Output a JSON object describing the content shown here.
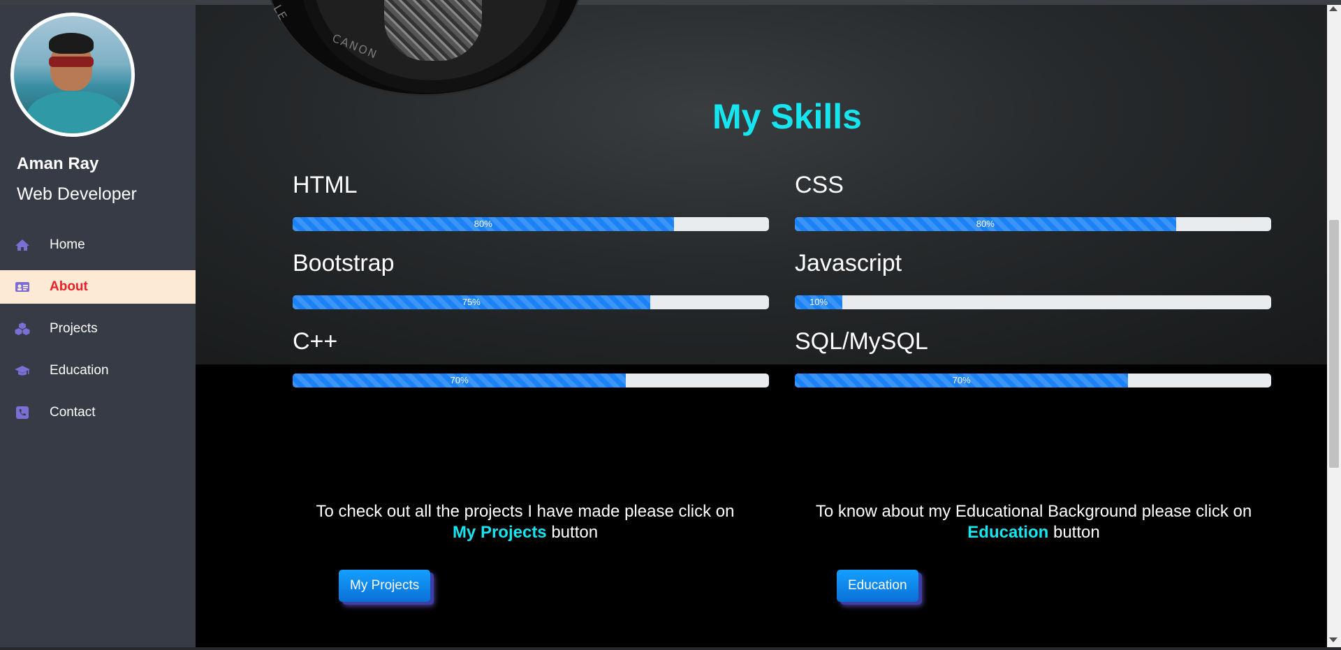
{
  "profile": {
    "name": "Aman Ray",
    "role": "Web Developer"
  },
  "nav": {
    "items": [
      {
        "label": "Home",
        "icon": "home-icon"
      },
      {
        "label": "About",
        "icon": "id-card-icon",
        "active": true
      },
      {
        "label": "Projects",
        "icon": "cubes-icon"
      },
      {
        "label": "Education",
        "icon": "graduation-cap-icon"
      },
      {
        "label": "Contact",
        "icon": "phone-icon"
      }
    ]
  },
  "hero": {
    "lens_text_1": "CANON",
    "lens_text_2": "LE"
  },
  "skills": {
    "title": "My Skills",
    "items": [
      {
        "name": "HTML",
        "percent": 80,
        "label": "80%"
      },
      {
        "name": "CSS",
        "percent": 80,
        "label": "80%"
      },
      {
        "name": "Bootstrap",
        "percent": 75,
        "label": "75%"
      },
      {
        "name": "Javascript",
        "percent": 10,
        "label": "10%"
      },
      {
        "name": "C++",
        "percent": 70,
        "label": "70%"
      },
      {
        "name": "SQL/MySQL",
        "percent": 70,
        "label": "70%"
      }
    ]
  },
  "cta": {
    "projects": {
      "text_before": "To check out all the projects I have made please click on",
      "highlight": "My Projects",
      "text_after": "button",
      "button_label": "My Projects"
    },
    "education": {
      "text_before": "To know about my Educational Background please click on",
      "highlight": "Education",
      "text_after": "button",
      "button_label": "Education"
    }
  },
  "colors": {
    "accent": "#16e4ee",
    "progress": "#1a82f5",
    "active_nav_bg": "#fdead4",
    "active_nav_text": "#e8202a",
    "sidebar_bg": "#363b45",
    "nav_icon": "#7b6fd6"
  }
}
